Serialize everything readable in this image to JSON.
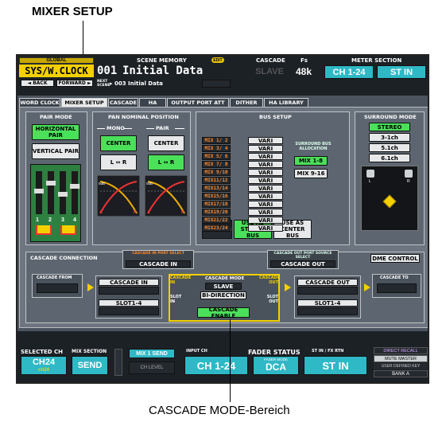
{
  "captions": {
    "top": "MIXER SETUP",
    "bottom": "CASCADE MODE-Bereich"
  },
  "header": {
    "global_label": "GLOBAL",
    "global_title": "SYS/W.CLOCK",
    "back_label": "◄ BACK",
    "forward_label": "FORWARD ►",
    "scene_memory_label": "SCENE MEMORY",
    "edit_badge": "EDIT",
    "scene_number": "001",
    "scene_title": "Initial Data",
    "next_scene_label": "NEXT SCENE",
    "next_scene_value": "▸ 003 Initial Data",
    "cascade_label": "CASCADE",
    "cascade_value": "SLAVE",
    "fs_label": "Fs",
    "fs_value": "48k",
    "meter_label": "METER SECTION",
    "meter_ch": "CH 1-24",
    "meter_st": "ST IN"
  },
  "tabs": [
    "WORD CLOCK",
    "MIXER SETUP",
    "CASCADE",
    "HA",
    "OUTPUT PORT ATT",
    "DITHER",
    "HA LIBRARY"
  ],
  "pair_mode": {
    "title": "PAIR MODE",
    "horizontal": "HORIZONTAL PAIR",
    "vertical": "VERTICAL PAIR",
    "channels": [
      "1",
      "2",
      "3",
      "4"
    ]
  },
  "pan": {
    "title": "PAN NOMINAL POSITION",
    "mono": "MONO",
    "pair": "PAIR",
    "center": "CENTER",
    "lr": "L ↔ R",
    "db": "0dB",
    "l": "L",
    "r": "R"
  },
  "bus_setup": {
    "title": "BUS SETUP",
    "mixes": [
      "MIX 1/ 2",
      "MIX 3/ 4",
      "MIX 5/ 6",
      "MIX 7/ 8",
      "MIX 9/10",
      "MIX11/12",
      "MIX13/14",
      "MIX15/16",
      "MIX17/18",
      "MIX19/20",
      "MIX21/22",
      "MIX23/24"
    ],
    "vari": "VARI",
    "surround_alloc": "SURROUND BUS ALLOCATION",
    "mix_1_8": "MIX 1-8",
    "mix_9_16": "MIX 9-16",
    "stereo_b": "STEREO B",
    "use_stereo": "USE AS STEREO BUS",
    "use_center": "USE AS CENTER BUS"
  },
  "surround": {
    "title": "SURROUND MODE",
    "modes": [
      "STEREO",
      "3-1ch",
      "5.1ch",
      "6.1ch"
    ],
    "l": "L",
    "r": "R"
  },
  "cascade": {
    "connection": "CASCADE CONNECTION",
    "in_port_label": "CASCADE IN PORT SELECT",
    "in_port_value": "CASCADE IN",
    "out_port_label": "CASCADE OUT PORT SOURCE SELECT",
    "out_port_value": "CASCADE OUT",
    "dme": "DME CONTROL",
    "from": "CASCADE FROM",
    "to": "CASCADE TO",
    "in": "CASCADE IN",
    "out": "CASCADE OUT",
    "slot_left": "SLOT1-4",
    "slot_right": "SLOT1-4",
    "mode_label": "CASCADE MODE",
    "mode_value": "SLAVE",
    "bidir": "BI-DIRECTION",
    "enable": "CASCADE ENABLE",
    "side_in": "CASCADE IN",
    "side_out": "CASCADE OUT",
    "slot_in": "SLOT IN",
    "slot_out": "SLOT OUT"
  },
  "footer": {
    "selected_ch_label": "SELECTED CH",
    "selected_ch": "CH24",
    "selected_sub": "ch24",
    "mix_section_label": "MIX SECTION",
    "mix_section": "SEND",
    "mix_send": "MIX 1 SEND",
    "ch_level": "CH LEVEL",
    "fader_status": "FADER STATUS",
    "input_ch_label": "INPUT CH",
    "input_ch": "CH 1-24",
    "fader_mode_label": "FADER MODE",
    "fader_mode": "DCA",
    "st_label": "ST IN / FX RTN",
    "st_value": "ST IN",
    "direct_recall": "DIRECT RECALL",
    "mute_master": "MUTE MASTER",
    "user_key": "USER DEFINED KEY",
    "bank": "BANK A"
  },
  "colors": {
    "accent_green": "#4be05a",
    "active_cyan": "#2ad4e0",
    "orange": "#ff8a2a"
  }
}
